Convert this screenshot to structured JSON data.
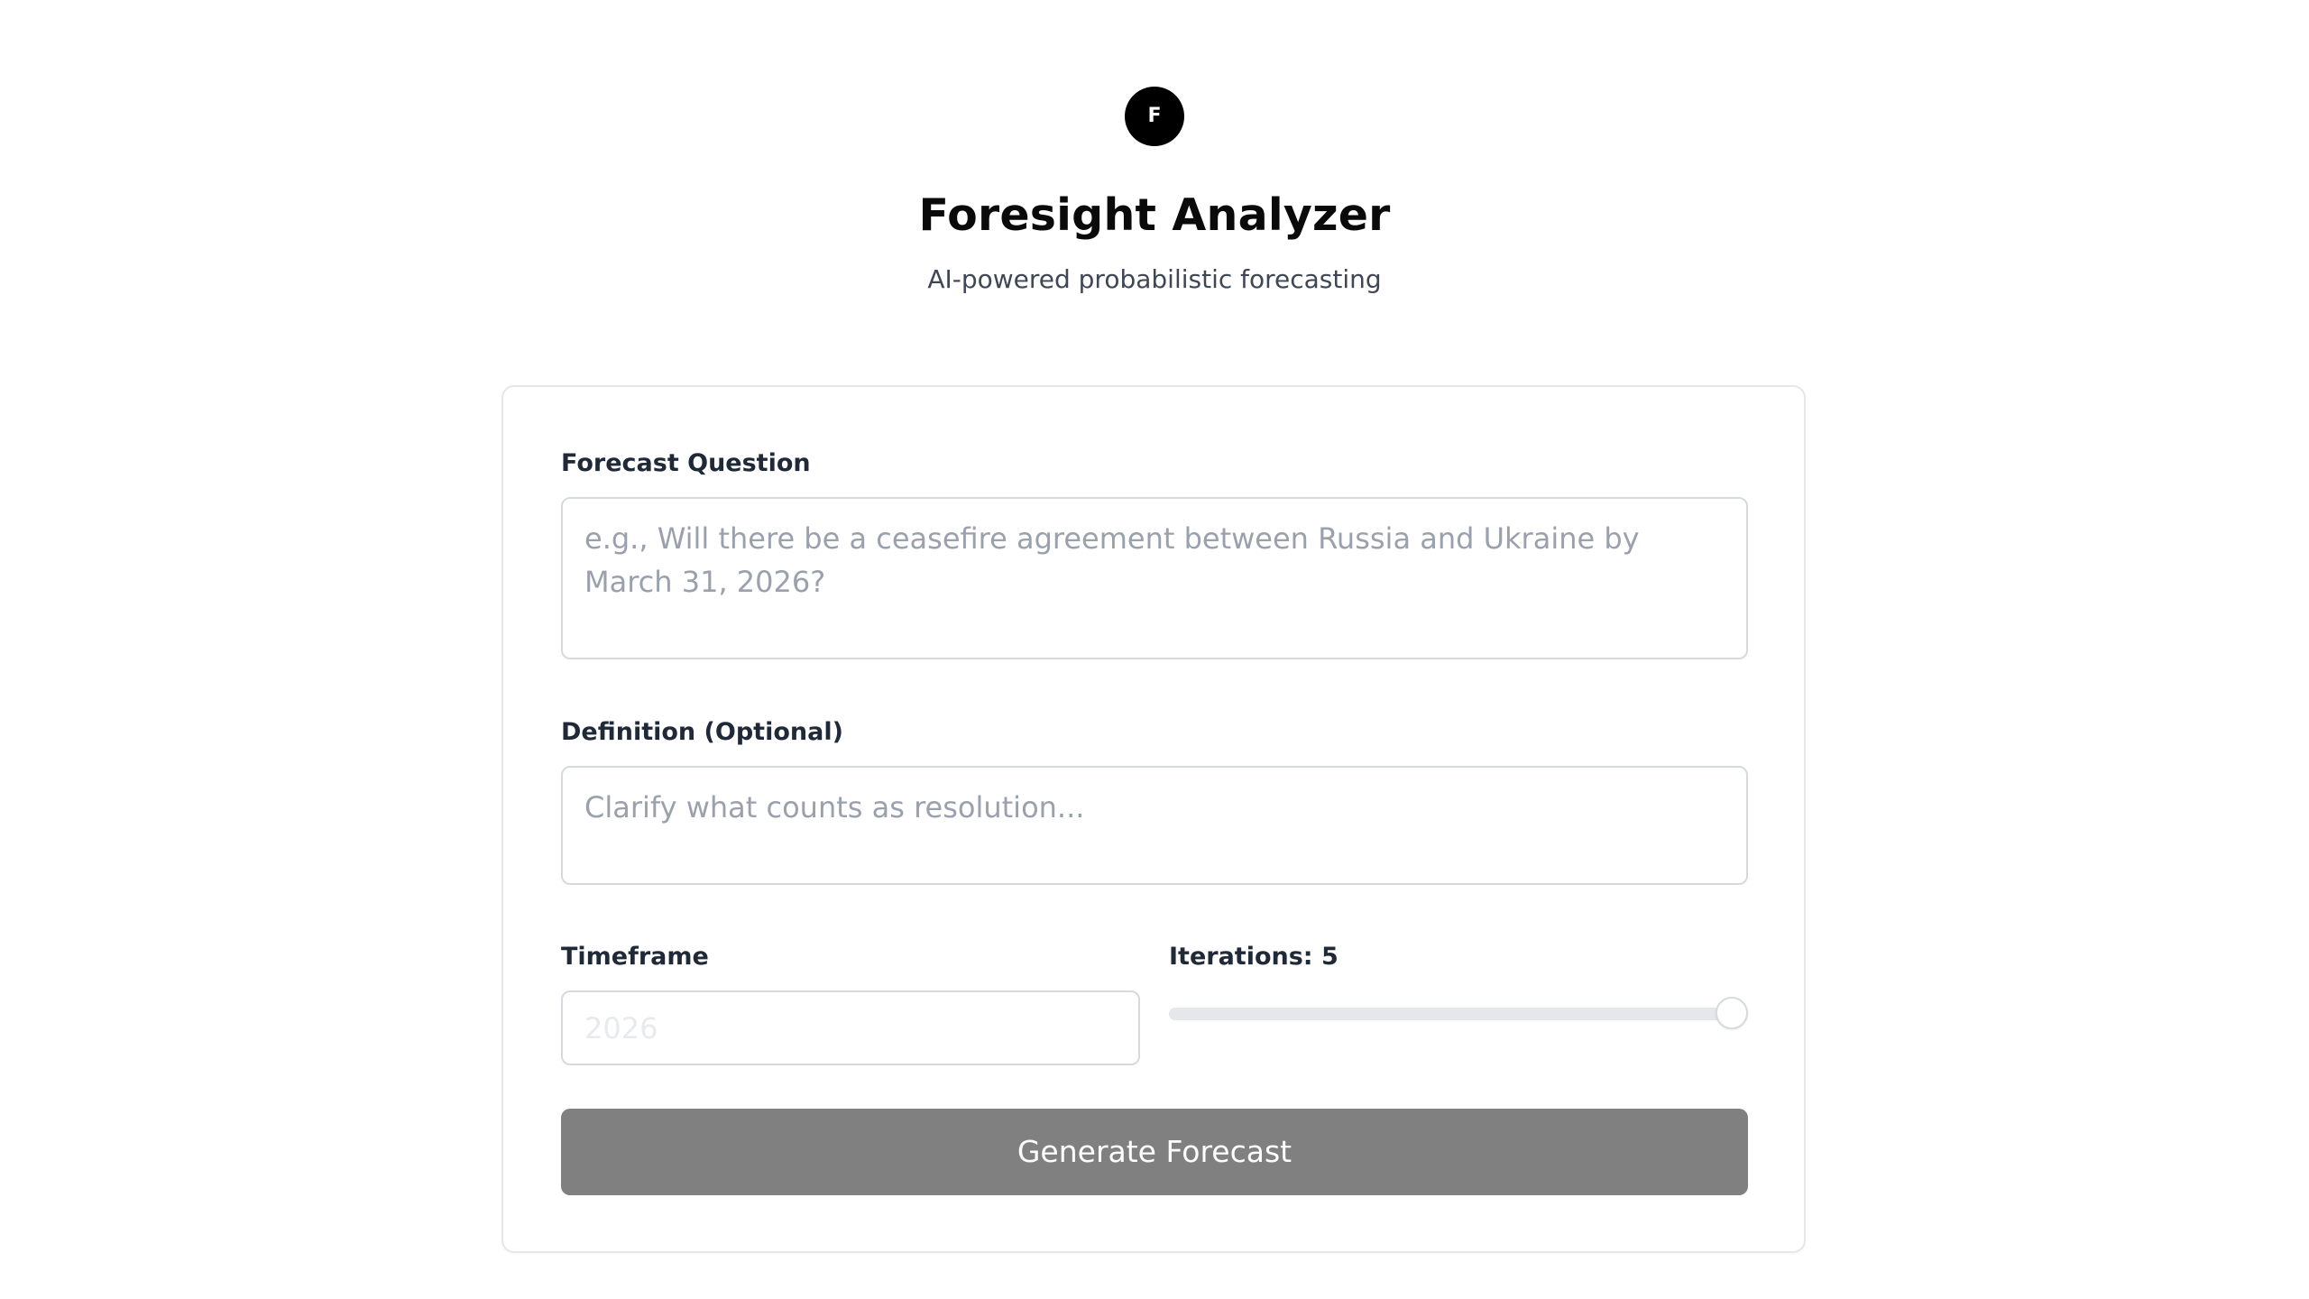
{
  "app": {
    "logo_letter": "F",
    "title": "Foresight Analyzer",
    "subtitle": "AI-powered probabilistic forecasting"
  },
  "form": {
    "question": {
      "label": "Forecast Question",
      "value": "",
      "placeholder": "e.g., Will there be a ceasefire agreement between Russia and Ukraine by March 31, 2026?"
    },
    "definition": {
      "label": "Definition (Optional)",
      "value": "",
      "placeholder": "Clarify what counts as resolution..."
    },
    "timeframe": {
      "label": "Timeframe",
      "value": "",
      "placeholder": "2026"
    },
    "iterations": {
      "label": "Iterations: 5",
      "value": 5,
      "position_fraction": 1.0
    },
    "submit_label": "Generate Forecast"
  },
  "colors": {
    "logo_bg": "#000000",
    "button_bg": "#808080",
    "border": "#d6d9de",
    "placeholder": "#9aa1ad"
  }
}
